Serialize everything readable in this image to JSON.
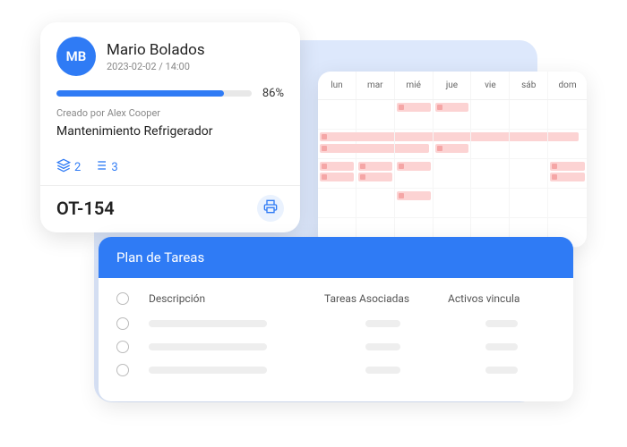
{
  "workCard": {
    "avatarInitials": "MB",
    "userName": "Mario Bolados",
    "dateTime": "2023-02-02 / 14:00",
    "progressPct": "86%",
    "createdBy": "Creado por Alex Cooper",
    "taskTitle": "Mantenimiento Refrigerador",
    "layersCount": "2",
    "listCount": "3",
    "otNumber": "OT-154"
  },
  "calendar": {
    "days": [
      "lun",
      "mar",
      "mié",
      "jue",
      "vie",
      "sáb",
      "dom"
    ]
  },
  "plan": {
    "title": "Plan de Tareas",
    "col1": "Descripción",
    "col2": "Tareas Asociadas",
    "col3": "Activos vincula"
  }
}
